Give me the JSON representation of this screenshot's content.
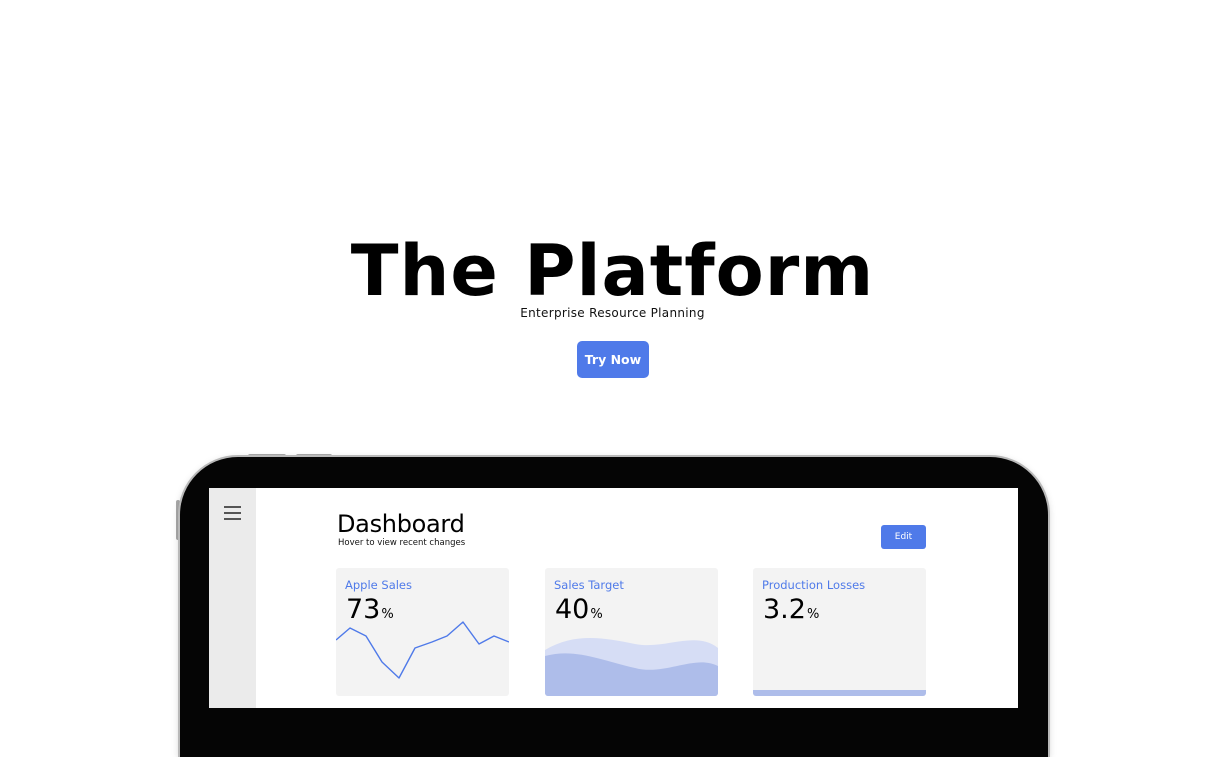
{
  "hero": {
    "title": "The Platform",
    "subtitle": "Enterprise Resource Planning",
    "cta_label": "Try Now",
    "accent_color": "#4f7ae9"
  },
  "device": {
    "menu_icon": "hamburger-menu-icon"
  },
  "dashboard": {
    "title": "Dashboard",
    "subtitle": "Hover to view recent changes",
    "edit_label": "Edit",
    "cards": [
      {
        "label": "Apple Sales",
        "value": "73",
        "unit": "%",
        "chart": "line"
      },
      {
        "label": "Sales Target",
        "value": "40",
        "unit": "%",
        "chart": "area"
      },
      {
        "label": "Production Losses",
        "value": "3.2",
        "unit": "%",
        "chart": "bar"
      }
    ]
  }
}
